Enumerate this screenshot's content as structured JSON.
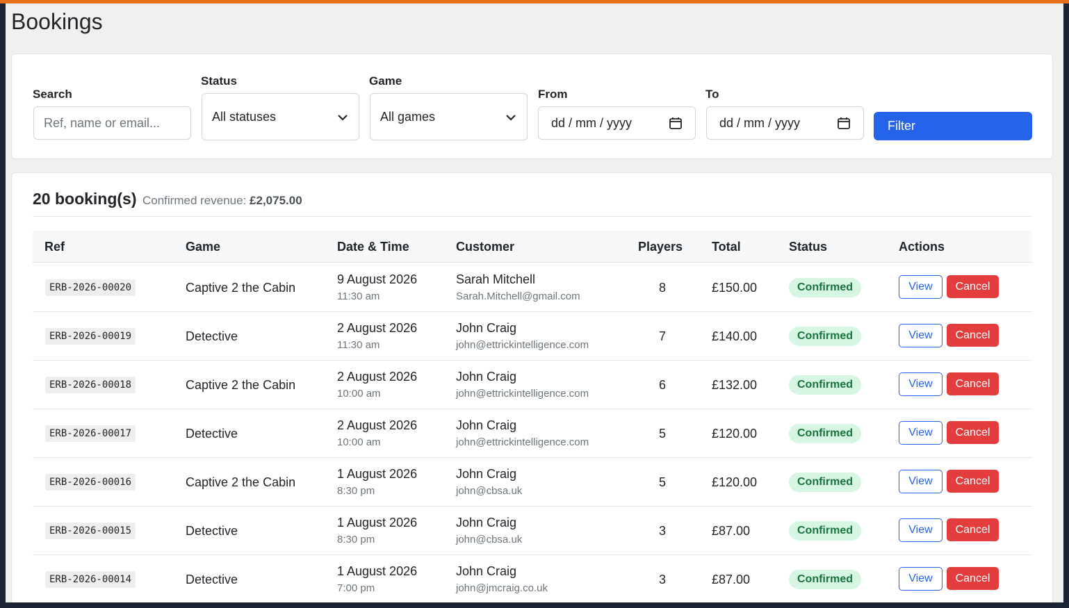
{
  "page": {
    "title": "Bookings"
  },
  "filters": {
    "search": {
      "label": "Search",
      "placeholder": "Ref, name or email..."
    },
    "status": {
      "label": "Status",
      "selected": "All statuses"
    },
    "game": {
      "label": "Game",
      "selected": "All games"
    },
    "from": {
      "label": "From",
      "placeholder": "dd / mm / yyyy"
    },
    "to": {
      "label": "To",
      "placeholder": "dd / mm / yyyy"
    },
    "filter_button": "Filter"
  },
  "summary": {
    "count_text": "20 booking(s)",
    "revenue_label": "Confirmed revenue:",
    "revenue_value": "£2,075.00"
  },
  "table": {
    "headers": {
      "ref": "Ref",
      "game": "Game",
      "datetime": "Date & Time",
      "customer": "Customer",
      "players": "Players",
      "total": "Total",
      "status": "Status",
      "actions": "Actions"
    },
    "view_label": "View",
    "cancel_label": "Cancel",
    "rows": [
      {
        "ref": "ERB-2026-00020",
        "game": "Captive 2 the Cabin",
        "date": "9 August 2026",
        "time": "11:30 am",
        "name": "Sarah Mitchell",
        "email": "Sarah.Mitchell@gmail.com",
        "players": "8",
        "total": "£150.00",
        "status": "Confirmed"
      },
      {
        "ref": "ERB-2026-00019",
        "game": "Detective",
        "date": "2 August 2026",
        "time": "11:30 am",
        "name": "John Craig",
        "email": "john@ettrickintelligence.com",
        "players": "7",
        "total": "£140.00",
        "status": "Confirmed"
      },
      {
        "ref": "ERB-2026-00018",
        "game": "Captive 2 the Cabin",
        "date": "2 August 2026",
        "time": "10:00 am",
        "name": "John Craig",
        "email": "john@ettrickintelligence.com",
        "players": "6",
        "total": "£132.00",
        "status": "Confirmed"
      },
      {
        "ref": "ERB-2026-00017",
        "game": "Detective",
        "date": "2 August 2026",
        "time": "10:00 am",
        "name": "John Craig",
        "email": "john@ettrickintelligence.com",
        "players": "5",
        "total": "£120.00",
        "status": "Confirmed"
      },
      {
        "ref": "ERB-2026-00016",
        "game": "Captive 2 the Cabin",
        "date": "1 August 2026",
        "time": "8:30 pm",
        "name": "John Craig",
        "email": "john@cbsa.uk",
        "players": "5",
        "total": "£120.00",
        "status": "Confirmed"
      },
      {
        "ref": "ERB-2026-00015",
        "game": "Detective",
        "date": "1 August 2026",
        "time": "8:30 pm",
        "name": "John Craig",
        "email": "john@cbsa.uk",
        "players": "3",
        "total": "£87.00",
        "status": "Confirmed"
      },
      {
        "ref": "ERB-2026-00014",
        "game": "Detective",
        "date": "1 August 2026",
        "time": "7:00 pm",
        "name": "John Craig",
        "email": "john@jmcraig.co.uk",
        "players": "3",
        "total": "£87.00",
        "status": "Confirmed"
      }
    ]
  },
  "colors": {
    "accent": "#2563eb",
    "danger": "#e43d3d",
    "success_bg": "#d7f5e3",
    "success_text": "#17743b",
    "top_bar": "#e8701a"
  }
}
